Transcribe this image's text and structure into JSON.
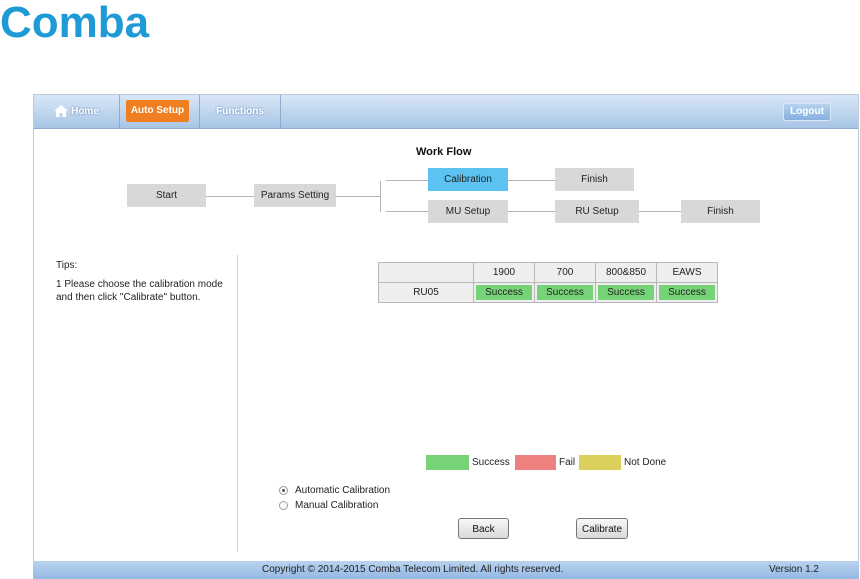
{
  "logo_text": "Comba",
  "nav": {
    "home": "Home",
    "auto_setup": "Auto Setup",
    "functions": "Functions",
    "logout": "Logout"
  },
  "workflow": {
    "title": "Work Flow",
    "start": "Start",
    "params": "Params Setting",
    "calibration": "Calibration",
    "finish1": "Finish",
    "mu_setup": "MU Setup",
    "ru_setup": "RU Setup",
    "finish2": "Finish"
  },
  "tips": {
    "heading": "Tips:",
    "line1": "1 Please choose the calibration mode and then click \"Calibrate\" button."
  },
  "table": {
    "headers": [
      "",
      "1900",
      "700",
      "800&850",
      "EAWS"
    ],
    "rows": [
      {
        "name": "RU05",
        "values": [
          "Success",
          "Success",
          "Success",
          "Success"
        ]
      }
    ]
  },
  "legend": {
    "success": "Success",
    "fail": "Fail",
    "not_done": "Not Done"
  },
  "colors": {
    "success": "#77d377",
    "fail": "#ee8080",
    "not_done": "#dcd05c",
    "active_step": "#5bc2f2",
    "accent": "#f07f22"
  },
  "calibration_mode": {
    "automatic": "Automatic Calibration",
    "manual": "Manual Calibration",
    "selected": "Automatic Calibration"
  },
  "buttons": {
    "back": "Back",
    "calibrate": "Calibrate"
  },
  "footer": {
    "copyright": "Copyright © 2014-2015 Comba Telecom Limited. All rights reserved.",
    "version": "Version 1.2"
  }
}
